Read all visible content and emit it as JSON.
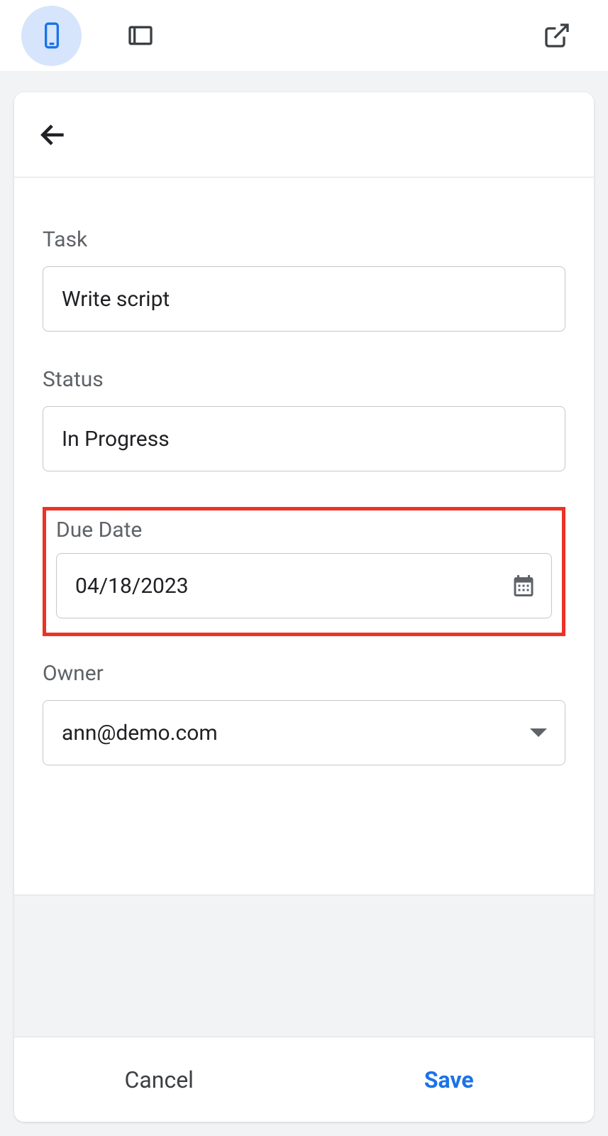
{
  "toolbar": {
    "icons": {
      "mobile": "mobile-icon",
      "tablet": "tablet-icon",
      "external": "external-link-icon"
    }
  },
  "form": {
    "task": {
      "label": "Task",
      "value": "Write script"
    },
    "status": {
      "label": "Status",
      "value": "In Progress"
    },
    "due_date": {
      "label": "Due Date",
      "value": "04/18/2023"
    },
    "owner": {
      "label": "Owner",
      "value": "ann@demo.com"
    }
  },
  "footer": {
    "cancel_label": "Cancel",
    "save_label": "Save"
  }
}
